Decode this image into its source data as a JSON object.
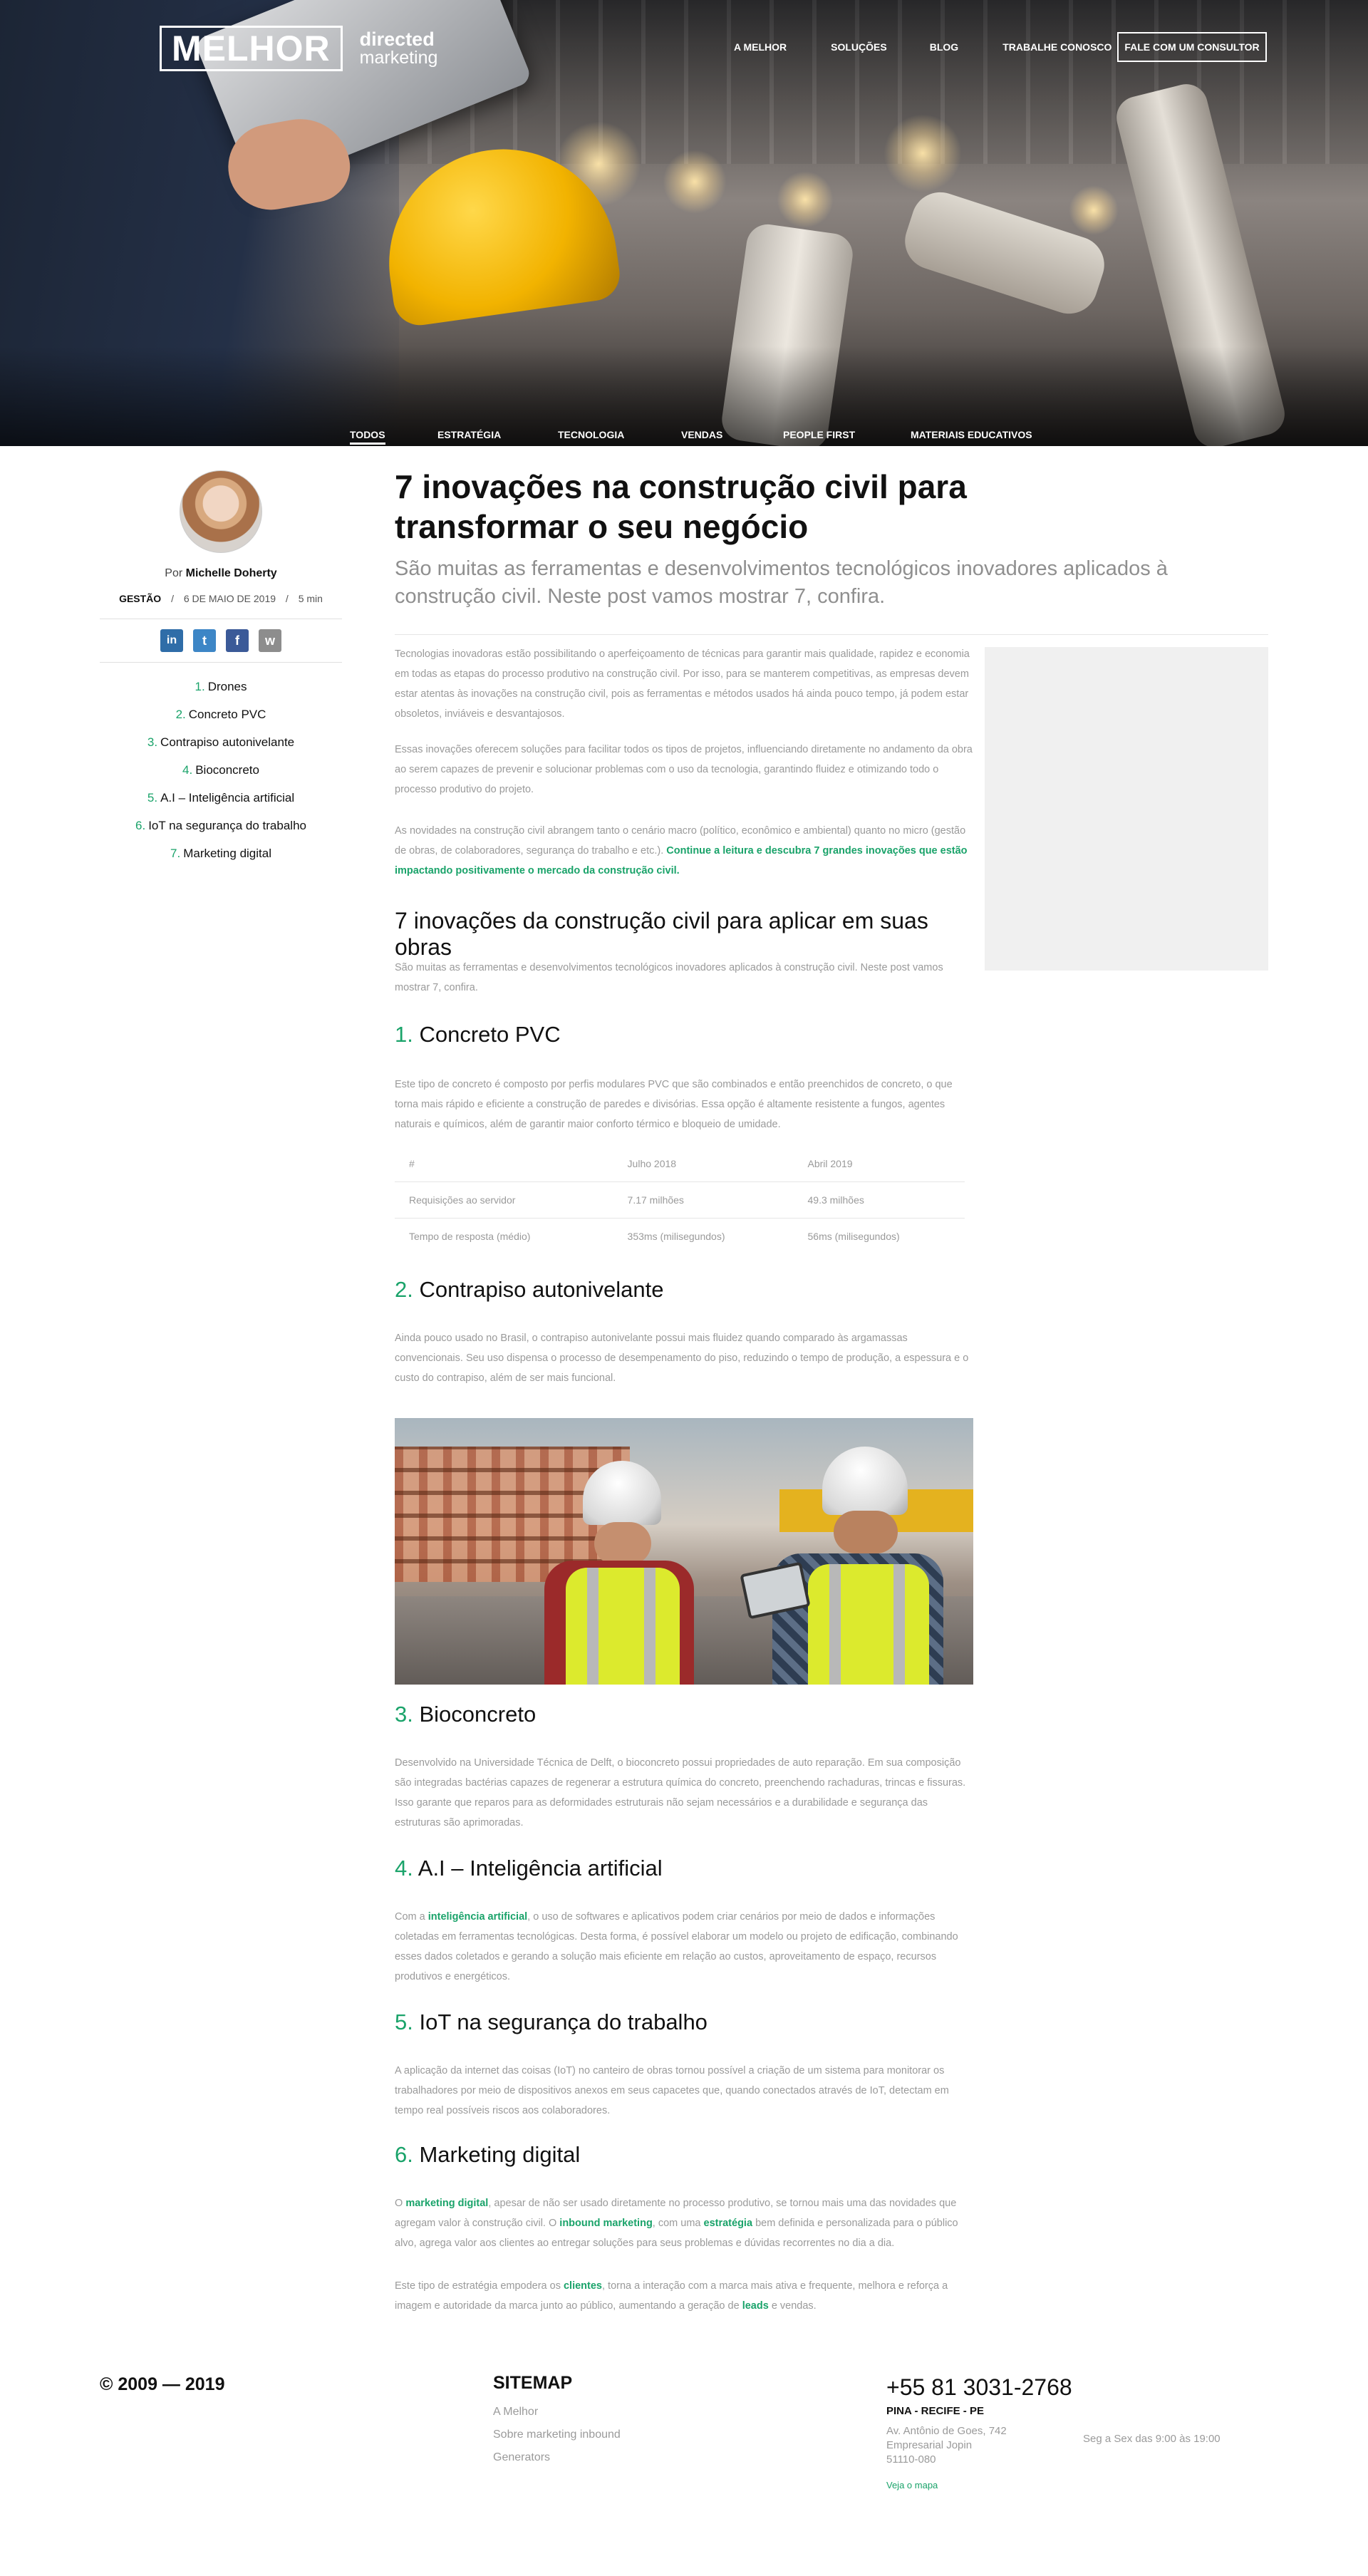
{
  "header": {
    "logo_main": "MELHOR",
    "logo_sub1": "directed",
    "logo_sub2": "marketing",
    "nav": [
      "A MELHOR",
      "SOLUÇÕES",
      "BLOG",
      "TRABALHE CONOSCO"
    ],
    "cta": "FALE COM UM CONSULTOR"
  },
  "categories": [
    "TODOS",
    "ESTRATÉGIA",
    "TECNOLOGIA",
    "VENDAS",
    "PEOPLE FIRST",
    "MATERIAIS EDUCATIVOS"
  ],
  "sidebar": {
    "author_prefix": "Por",
    "author": "Michelle Doherty",
    "category": "GESTÃO",
    "date": "6 DE MAIO DE 2019",
    "read_time": "5 min",
    "share": [
      "in",
      "t",
      "f",
      "w"
    ],
    "toc": [
      {
        "n": "1.",
        "label": "Drones"
      },
      {
        "n": "2.",
        "label": "Concreto PVC"
      },
      {
        "n": "3.",
        "label": "Contrapiso autonivelante"
      },
      {
        "n": "4.",
        "label": "Bioconcreto"
      },
      {
        "n": "5.",
        "label": "A.I – Inteligência artificial"
      },
      {
        "n": "6.",
        "label": "IoT na segurança do trabalho"
      },
      {
        "n": "7.",
        "label": "Marketing digital"
      }
    ]
  },
  "article": {
    "title": "7 inovações na construção civil para transformar o seu negócio",
    "subtitle": "São muitas as ferramentas e desenvolvimentos tecnológicos inovadores aplicados à construção civil. Neste post vamos mostrar 7, confira.",
    "intro_p1": "Tecnologias inovadoras estão possibilitando o aperfeiçoamento de técnicas para garantir mais qualidade, rapidez e economia em todas as etapas do processo produtivo na construção civil. Por isso, para se manterem competitivas, as empresas devem estar atentas às inovações na construção civil, pois as ferramentas e métodos usados há ainda pouco tempo, já podem estar obsoletos, inviáveis e desvantajosos.",
    "intro_p2": "Essas inovações oferecem soluções para facilitar todos os tipos de projetos, influenciando diretamente no andamento da obra ao serem capazes de prevenir e solucionar problemas com o uso da tecnologia, garantindo fluidez e otimizando todo o processo produtivo do projeto.",
    "intro_p3_start": "As novidades na construção civil abrangem tanto o cenário macro (político, econômico e ambiental) quanto no micro (gestão de obras, de colaboradores, segurança do trabalho e etc.).",
    "intro_p3_link": "Continue a leitura e descubra 7 grandes inovações que estão impactando positivamente o mercado da construção civil.",
    "section_title": "7 inovações da construção civil para aplicar em suas obras",
    "section_p": "São muitas as ferramentas e desenvolvimentos tecnológicos inovadores aplicados à construção civil. Neste post vamos mostrar 7, confira.",
    "h_pvc_n": "1.",
    "h_pvc": "Concreto PVC",
    "pvc_p": "Este tipo de concreto é composto por perfis modulares PVC que são combinados e então preenchidos de concreto, o que torna mais rápido e eficiente a construção de paredes e divisórias. Essa opção é altamente resistente a fungos, agentes naturais e químicos, além de garantir maior conforto térmico e bloqueio de umidade.",
    "table": {
      "headers": [
        "#",
        "Julho 2018",
        "Abril 2019"
      ],
      "rows": [
        [
          "Requisições ao servidor",
          "7.17 milhões",
          "49.3 milhões"
        ],
        [
          "Tempo de resposta (médio)",
          "353ms (milisegundos)",
          "56ms (milisegundos)"
        ]
      ]
    },
    "h_contra_n": "2.",
    "h_contra": "Contrapiso autonivelante",
    "contra_p": "Ainda pouco usado no Brasil, o contrapiso autonivelante possui mais fluidez quando comparado às argamassas convencionais. Seu uso dispensa o processo de desempenamento do piso, reduzindo o tempo de produção, a espessura e o custo do contrapiso, além de ser mais funcional.",
    "h_bio_n": "3.",
    "h_bio": "Bioconcreto",
    "bio_p": "Desenvolvido na Universidade Técnica de Delft, o bioconcreto possui propriedades de auto reparação. Em sua composição são integradas bactérias capazes de regenerar a estrutura química do concreto, preenchendo rachaduras, trincas e fissuras. Isso garante que reparos para as deformidades estruturais não sejam necessários e a durabilidade e segurança das estruturas são aprimoradas.",
    "h_ai_n": "4.",
    "h_ai": "A.I – Inteligência artificial",
    "ai_p_a": "Com a",
    "ai_p_link": "inteligência artificial",
    "ai_p_b": ", o uso de softwares e aplicativos podem criar cenários por meio de dados e informações coletadas em ferramentas tecnológicas. Desta forma, é possível elaborar um modelo ou projeto de edificação, combinando esses dados coletados e gerando a solução mais eficiente em relação ao custos, aproveitamento de espaço, recursos produtivos e energéticos.",
    "h_iot_n": "5.",
    "h_iot": "IoT na segurança do trabalho",
    "iot_p": "A aplicação da internet das coisas (IoT) no canteiro de obras tornou possível a criação de um sistema para monitorar os trabalhadores por meio de dispositivos anexos em seus capacetes que, quando conectados através de IoT, detectam em tempo real possíveis riscos aos colaboradores.",
    "h_mkt_n": "6.",
    "h_mkt": "Marketing digital",
    "mkt_p1_a": "O",
    "mkt_p1_l1": "marketing digital",
    "mkt_p1_b": ", apesar de não ser usado diretamente no processo produtivo, se tornou mais uma das novidades que agregam valor à construção civil. O",
    "mkt_p1_l2": "inbound marketing",
    "mkt_p1_c": ", com uma",
    "mkt_p1_l3": "estratégia",
    "mkt_p1_d": "bem definida e personalizada para o público alvo, agrega valor aos clientes ao entregar soluções para seus problemas e dúvidas recorrentes no dia a dia.",
    "mkt_p2_a": "Este tipo de estratégia empodera os",
    "mkt_p2_l1": "clientes",
    "mkt_p2_b": ", torna a interação com a marca mais ativa e frequente, melhora e reforça a imagem e autoridade da marca junto ao público, aumentando a geração de",
    "mkt_p2_l2": "leads",
    "mkt_p2_c": "e vendas."
  },
  "footer": {
    "copyright": "© 2009 — 2019",
    "sitemap_title": "SITEMAP",
    "sitemap_links": [
      "A Melhor",
      "Sobre marketing inbound",
      "Generators"
    ],
    "phone": "+55 81 3031-2768",
    "city": "PINA - RECIFE - PE",
    "address": [
      "Av. Antônio de Goes, 742",
      "Empresarial Jopin",
      "51110-080"
    ],
    "hours": "Seg a Sex das 9:00 às 19:00",
    "map_link": "Veja o mapa"
  },
  "colors": {
    "accent": "#1aa36a",
    "text": "#111111",
    "muted": "#9a9a9a"
  }
}
